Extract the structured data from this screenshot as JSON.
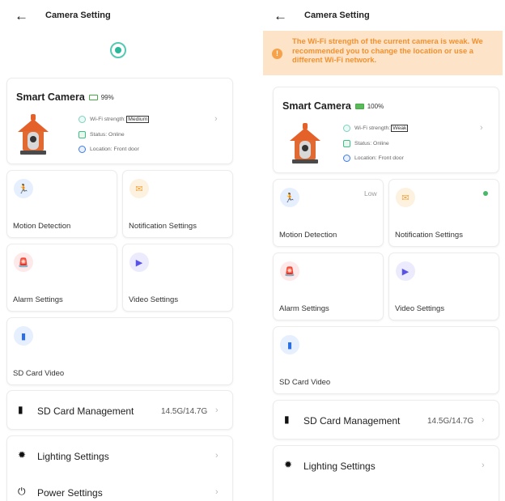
{
  "left": {
    "title": "Camera Setting",
    "camera": {
      "name": "Smart Camera",
      "battery": "99%",
      "wifi_label": "Wi-Fi strength:",
      "wifi_value": "Medium",
      "status": "Status: Online",
      "location": "Location: Front door"
    },
    "tiles": [
      {
        "label": "Motion Detection",
        "icon": "runner-icon"
      },
      {
        "label": "Notification Settings",
        "icon": "envelope-icon"
      },
      {
        "label": "Alarm Settings",
        "icon": "siren-icon"
      },
      {
        "label": "Video Settings",
        "icon": "video-icon"
      },
      {
        "label": "SD Card Video",
        "icon": "sd-card-icon"
      }
    ],
    "rows": [
      {
        "label": "SD Card Management",
        "value": "14.5G/14.7G",
        "icon": "sd-card-icon"
      },
      {
        "label": "Lighting Settings",
        "icon": "bulb-icon"
      },
      {
        "label": "Power Settings",
        "icon": "power-icon"
      }
    ]
  },
  "right": {
    "title": "Camera Setting",
    "warning": "The Wi-Fi strength of the current camera is weak. We recommended you to change the location or use a different Wi-Fi network.",
    "camera": {
      "name": "Smart Camera",
      "battery": "100%",
      "wifi_label": "Wi-Fi strength:",
      "wifi_value": "Weak",
      "status": "Status: Online",
      "location": "Location: Front door"
    },
    "tiles": [
      {
        "label": "Motion Detection",
        "extra": "Low",
        "icon": "runner-icon"
      },
      {
        "label": "Notification Settings",
        "icon": "envelope-icon"
      },
      {
        "label": "Alarm Settings",
        "icon": "siren-icon"
      },
      {
        "label": "Video Settings",
        "icon": "video-icon"
      },
      {
        "label": "SD Card Video",
        "icon": "sd-card-icon"
      }
    ],
    "rows": [
      {
        "label": "SD Card Management",
        "value": "14.5G/14.7G",
        "icon": "sd-card-icon"
      },
      {
        "label": "Lighting Settings",
        "icon": "bulb-icon"
      }
    ]
  },
  "glyphs": {
    "back": "←",
    "chevron": "›",
    "warn": "!",
    "runner": "🏃",
    "envelope": "✉",
    "siren": "🚨",
    "video": "▶",
    "sd": "▮",
    "bulb": "✹",
    "power": "⏻"
  }
}
